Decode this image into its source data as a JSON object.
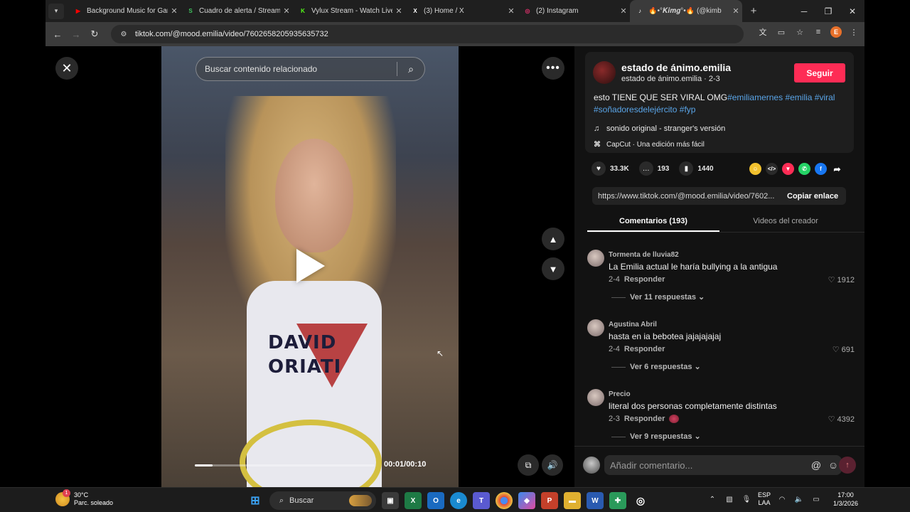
{
  "browser": {
    "tabs": [
      {
        "title": "Background Music for Gam",
        "icon_color": "#ff0000",
        "icon": "youtube-icon",
        "active": false
      },
      {
        "title": "Cuadro de alerta / Streamli",
        "icon_color": "#3fc45e",
        "icon": "streamlabs-icon",
        "active": false
      },
      {
        "title": "Vylux Stream - Watch Live",
        "icon_color": "#53fc18",
        "icon": "kick-icon",
        "active": false
      },
      {
        "title": "(3) Home / X",
        "icon_color": "#ffffff",
        "icon": "x-icon",
        "active": false
      },
      {
        "title": "(2) Instagram",
        "icon_color": "#e1306c",
        "icon": "instagram-icon",
        "active": false
      },
      {
        "title": "🔥•°𝑲𝒊𝒎𝒈°•🔥 (@kimb",
        "icon_color": "#ffffff",
        "icon": "tiktok-icon",
        "active": true
      }
    ],
    "url": "tiktok.com/@mood.emilia/video/7602658205935635732",
    "profile_initial": "E"
  },
  "player": {
    "search_placeholder": "Buscar contenido relacionado",
    "time": "00:01/00:10",
    "progress": 0.1,
    "video_text": "DAVID\nORIATI"
  },
  "post": {
    "author_name": "estado de ánimo.emilia",
    "author_sub": "estado de ánimo.emilia · 2-3",
    "follow_label": "Seguir",
    "desc_plain": "esto TIENE QUE SER VIRAL OMG",
    "hashtags": [
      "#emiliamernes",
      "#emilia",
      "#viral",
      "#soñadoresdelejército",
      "#fyp"
    ],
    "music": "sonido original - stranger's versión",
    "capcut": "CapCut · Una edición más fácil",
    "likes": "33.3K",
    "comments_count": "193",
    "saves": "1440",
    "link": "https://www.tiktok.com/@mood.emilia/video/7602...",
    "copy_label": "Copiar enlace",
    "accent": "#fe2c55"
  },
  "tabs": {
    "comments": "Comentarios (193)",
    "creator": "Videos del creador"
  },
  "comments": [
    {
      "user": "Tormenta de lluvia82",
      "text": "La Emilia actual le haría bullying a la antigua",
      "date": "2-4",
      "reply": "Responder",
      "likes": "1912",
      "replies": "Ver 11 respuestas"
    },
    {
      "user": "Agustina Abril",
      "text": "hasta en ia bebotea jajajajajaj",
      "date": "2-4",
      "reply": "Responder",
      "likes": "691",
      "replies": "Ver 6 respuestas"
    },
    {
      "user": "Precio",
      "text": "literal dos personas completamente distintas",
      "date": "2-3",
      "reply": "Responder",
      "likes": "4392",
      "replies": "Ver 9 respuestas"
    }
  ],
  "comment_box": {
    "placeholder": "Añadir comentario..."
  },
  "taskbar": {
    "temp": "30°C",
    "weather": "Parc. soleado",
    "weather_badge": "1",
    "search": "Buscar",
    "lang1": "ESP",
    "lang2": "LAA",
    "time": "17:00",
    "date": "1/3/2026"
  }
}
